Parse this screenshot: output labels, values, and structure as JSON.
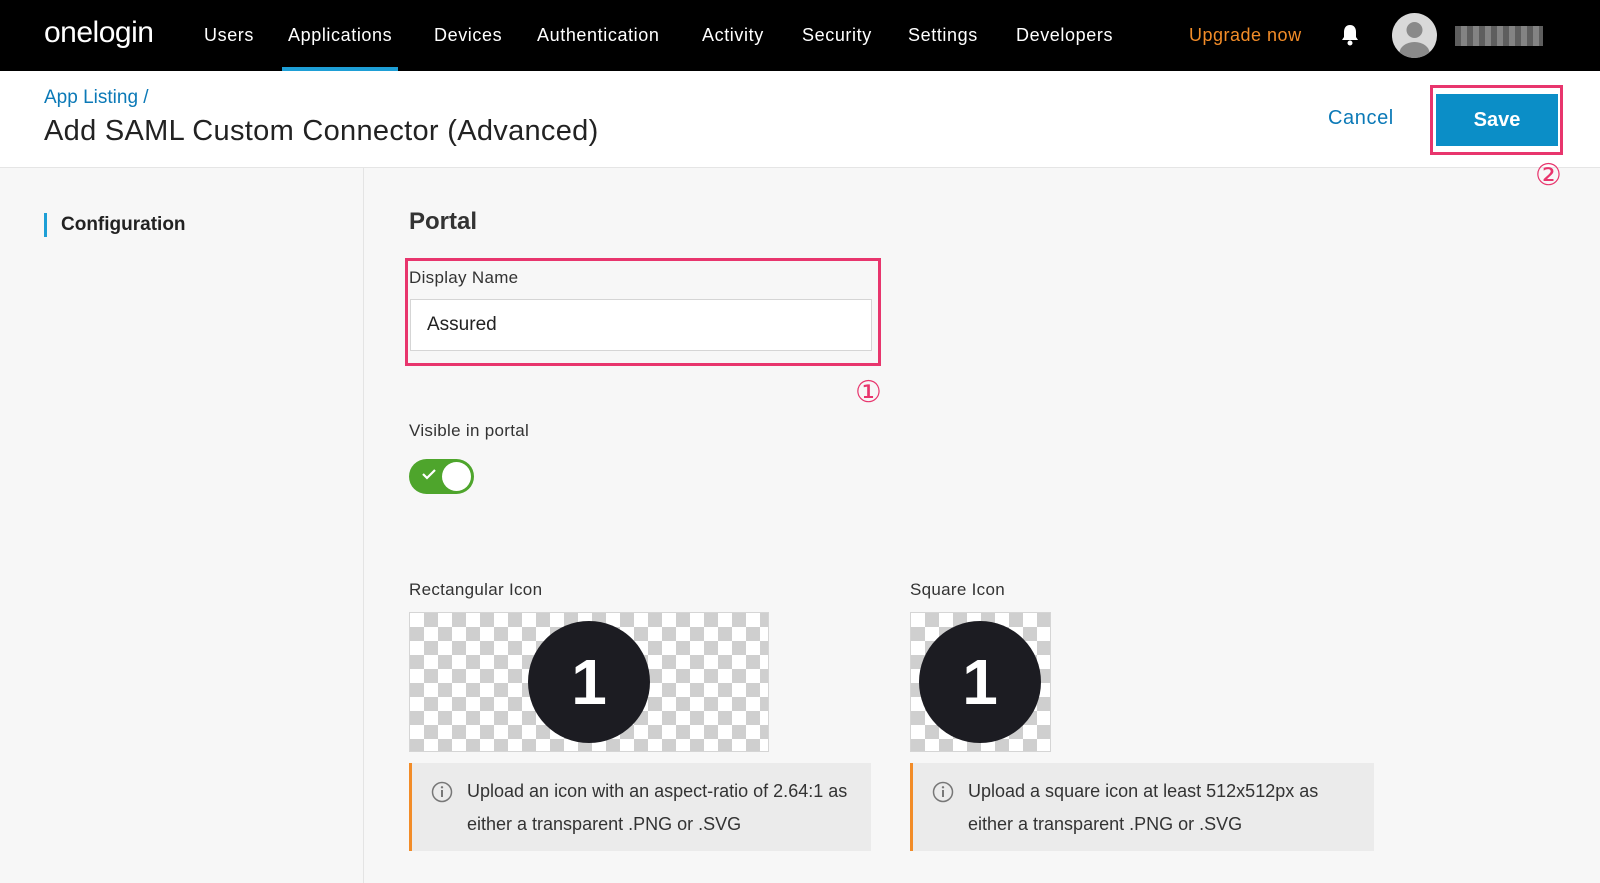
{
  "nav": {
    "logo": "onelogin",
    "items": [
      "Users",
      "Applications",
      "Devices",
      "Authentication",
      "Activity",
      "Security",
      "Settings",
      "Developers"
    ],
    "active": "Applications",
    "upgrade": "Upgrade now"
  },
  "header": {
    "breadcrumb": "App Listing /",
    "title": "Add SAML Custom Connector (Advanced)",
    "cancel": "Cancel",
    "save": "Save"
  },
  "callouts": {
    "one": "①",
    "two": "②"
  },
  "sidebar": {
    "items": [
      "Configuration"
    ]
  },
  "portal": {
    "section_title": "Portal",
    "display_name_label": "Display Name",
    "display_name_value": "Assured",
    "visible_label": "Visible in portal",
    "visible_on": true,
    "rect_icon_label": "Rectangular Icon",
    "square_icon_label": "Square Icon",
    "rect_info_line1": "Upload an icon with an aspect-ratio of 2.64:1 as",
    "rect_info_line2": "either a transparent .PNG or .SVG",
    "square_info_line1": "Upload a square icon at least 512x512px as",
    "square_info_line2": "either a transparent .PNG or .SVG",
    "icon_glyph": "1"
  },
  "colors": {
    "accent": "#0b8ec7",
    "link": "#0b79b7",
    "upgrade": "#f28c28",
    "callout": "#e8356d",
    "toggle_on": "#4ea52c"
  },
  "icons": [
    "bell-icon",
    "avatar-icon",
    "check-icon",
    "info-icon"
  ]
}
